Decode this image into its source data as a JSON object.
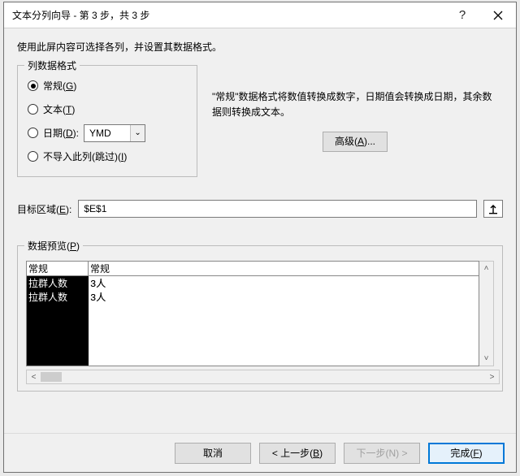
{
  "titlebar": {
    "title": "文本分列向导 - 第 3 步，共 3 步"
  },
  "instruction": "使用此屏内容可选择各列，并设置其数据格式。",
  "format_group": {
    "legend": "列数据格式",
    "general": "常规(G)",
    "text": "文本(T)",
    "date": "日期(D):",
    "date_format": "YMD",
    "skip": "不导入此列(跳过)(I)",
    "selected": "general"
  },
  "info": {
    "text": "\"常规\"数据格式将数值转换成数字，日期值会转换成日期，其余数据则转换成文本。",
    "advanced": "高级(A)..."
  },
  "destination": {
    "label": "目标区域(E):",
    "value": "$E$1"
  },
  "preview": {
    "legend": "数据预览(P)",
    "headers": [
      "常规",
      "常规"
    ],
    "rows": [
      [
        "拉群人数",
        "3人"
      ],
      [
        "拉群人数",
        "3人"
      ]
    ]
  },
  "footer": {
    "cancel": "取消",
    "back": "< 上一步(B)",
    "next": "下一步(N) >",
    "finish": "完成(F)"
  }
}
